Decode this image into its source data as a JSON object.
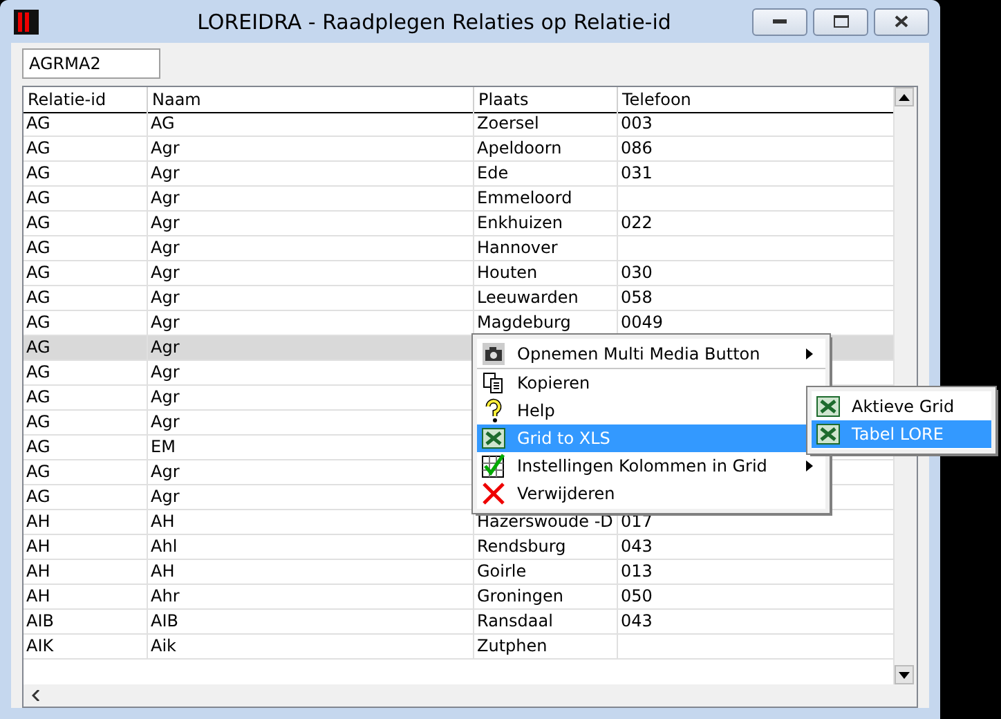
{
  "window": {
    "title": "LOREIDRA - Raadplegen Relaties op Relatie-id"
  },
  "search": {
    "value": "AGRMA2"
  },
  "table": {
    "columns": [
      "Relatie-id",
      "Naam",
      "Plaats",
      "Telefoon"
    ],
    "rows": [
      {
        "cells": [
          "AG",
          "AG",
          "Zoersel",
          "003"
        ],
        "selected": false
      },
      {
        "cells": [
          "AG",
          "Agr",
          "Apeldoorn",
          "086"
        ],
        "selected": false
      },
      {
        "cells": [
          "AG",
          "Agr",
          "Ede",
          "031"
        ],
        "selected": false
      },
      {
        "cells": [
          "AG",
          "Agr",
          "Emmeloord",
          ""
        ],
        "selected": false
      },
      {
        "cells": [
          "AG",
          "Agr",
          "Enkhuizen",
          "022"
        ],
        "selected": false
      },
      {
        "cells": [
          "AG",
          "Agr",
          "Hannover",
          ""
        ],
        "selected": false
      },
      {
        "cells": [
          "AG",
          "Agr",
          "Houten",
          "030"
        ],
        "selected": false
      },
      {
        "cells": [
          "AG",
          "Agr",
          "Leeuwarden",
          "058"
        ],
        "selected": false
      },
      {
        "cells": [
          "AG",
          "Agr",
          "Magdeburg",
          "0049"
        ],
        "selected": false
      },
      {
        "cells": [
          "AG",
          "Agr",
          "",
          ""
        ],
        "selected": true
      },
      {
        "cells": [
          "AG",
          "Agr",
          "",
          ""
        ],
        "selected": false
      },
      {
        "cells": [
          "AG",
          "Agr",
          "",
          ""
        ],
        "selected": false
      },
      {
        "cells": [
          "AG",
          "Agr",
          "",
          ""
        ],
        "selected": false
      },
      {
        "cells": [
          "AG",
          "EM",
          "",
          ""
        ],
        "selected": false
      },
      {
        "cells": [
          "AG",
          "Agr",
          "",
          ""
        ],
        "selected": false
      },
      {
        "cells": [
          "AG",
          "Agr",
          "",
          ""
        ],
        "selected": false
      },
      {
        "cells": [
          "AH",
          "AH",
          "Hazerswoude -D",
          "017"
        ],
        "selected": false
      },
      {
        "cells": [
          "AH",
          "Ahl",
          "Rendsburg",
          "043"
        ],
        "selected": false
      },
      {
        "cells": [
          "AH",
          "AH",
          "Goirle",
          "013"
        ],
        "selected": false
      },
      {
        "cells": [
          "AH",
          "Ahr",
          "Groningen",
          "050"
        ],
        "selected": false
      },
      {
        "cells": [
          "AIB",
          "AIB",
          "Ransdaal",
          "043"
        ],
        "selected": false
      },
      {
        "cells": [
          "AIK",
          "Aik",
          "Zutphen",
          ""
        ],
        "selected": false
      }
    ]
  },
  "context_menu": {
    "items": [
      {
        "kind": "camera",
        "label": "Opnemen Multi Media Button",
        "submenu": true,
        "selected": false
      },
      {
        "kind": "copy",
        "label": "Kopieren",
        "submenu": false,
        "selected": false
      },
      {
        "kind": "help",
        "label": "Help",
        "submenu": false,
        "selected": false
      },
      {
        "kind": "excel",
        "label": "Grid to XLS",
        "submenu": false,
        "selected": true
      },
      {
        "kind": "check",
        "label": "Instellingen Kolommen in Grid",
        "submenu": true,
        "selected": false
      },
      {
        "kind": "delete",
        "label": "Verwijderen",
        "submenu": false,
        "selected": false
      }
    ]
  },
  "submenu": {
    "items": [
      {
        "kind": "excel",
        "label": "Aktieve Grid",
        "selected": false
      },
      {
        "kind": "excel",
        "label": "Tabel LORE",
        "selected": true
      }
    ]
  }
}
